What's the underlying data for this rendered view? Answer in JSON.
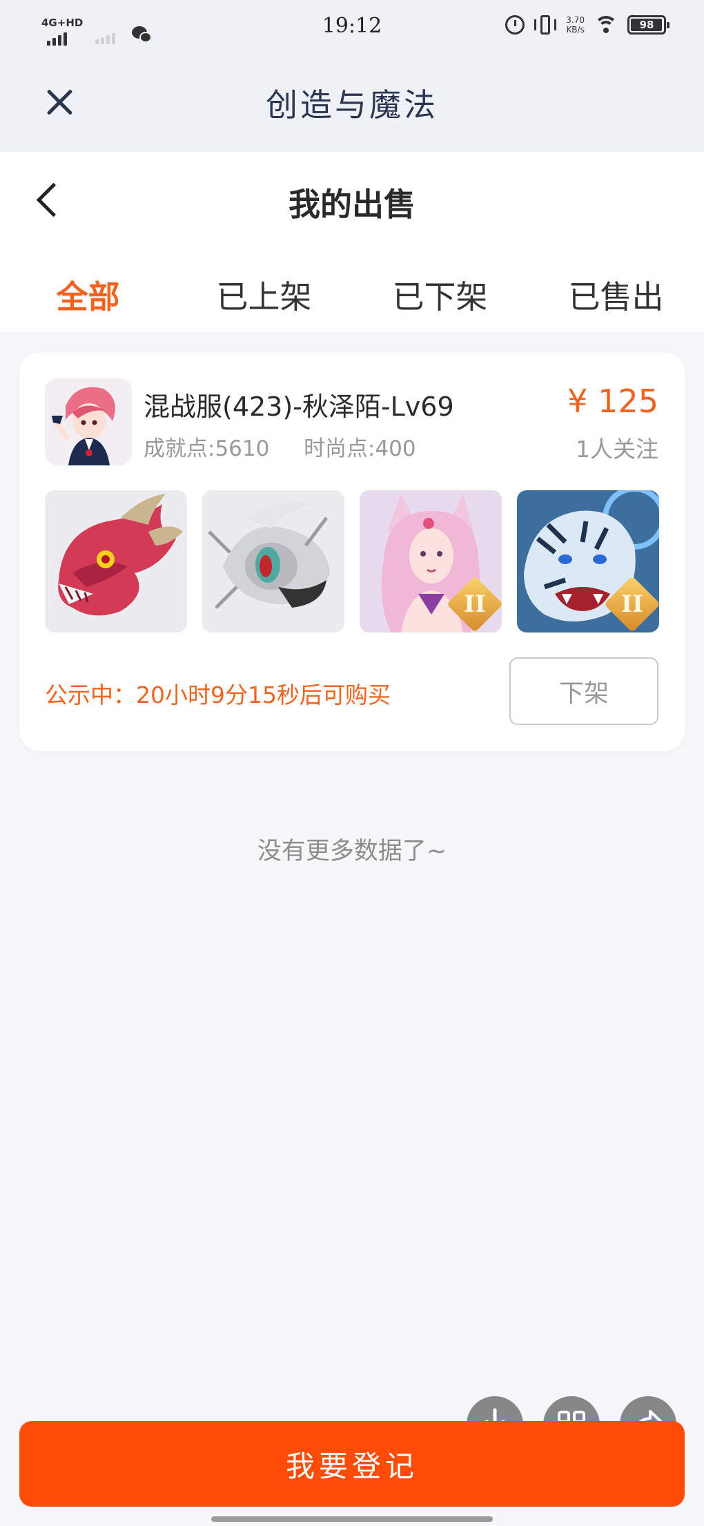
{
  "status_bar": {
    "network": "4G+HD",
    "time": "19:12",
    "speed_value": "3.70",
    "speed_unit": "KB/s",
    "battery": "98"
  },
  "app_bar": {
    "title": "创造与魔法"
  },
  "page": {
    "title": "我的出售"
  },
  "tabs": [
    {
      "label": "全部",
      "active": true
    },
    {
      "label": "已上架",
      "active": false
    },
    {
      "label": "已下架",
      "active": false
    },
    {
      "label": "已售出",
      "active": false
    }
  ],
  "listing": {
    "title": "混战服(423)-秋泽陌-Lv69",
    "achievement": "成就点:5610",
    "fashion": "时尚点:400",
    "price": "¥ 125",
    "followers": "1人关注",
    "thumbnails": [
      {
        "name": "red-dragon-mount",
        "badge": ""
      },
      {
        "name": "silver-insect-mount",
        "badge": ""
      },
      {
        "name": "fox-girl-costume",
        "badge": "II"
      },
      {
        "name": "blue-tiger-mount",
        "badge": "II"
      }
    ],
    "notice": "公示中：20小时9分15秒后可购买",
    "delist_label": "下架"
  },
  "empty_text": "没有更多数据了~",
  "bottom": {
    "register_label": "我要登记"
  },
  "colors": {
    "accent": "#f2631f",
    "primary_button": "#fd4c07",
    "app_bar_bg": "#eef2f6",
    "title_ink": "#2c3550"
  }
}
